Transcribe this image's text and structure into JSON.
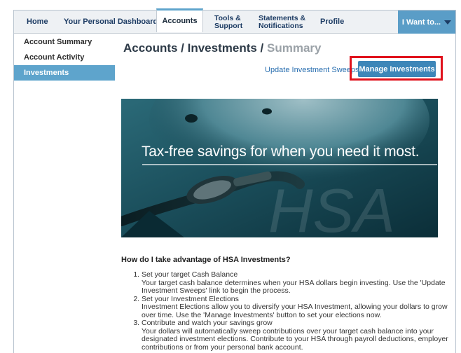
{
  "nav": {
    "items": [
      {
        "label": "Home"
      },
      {
        "label": "Your Personal Dashboard"
      },
      {
        "label": "Accounts"
      },
      {
        "line1": "Tools &",
        "line2": "Support"
      },
      {
        "line1": "Statements &",
        "line2": "Notifications"
      },
      {
        "label": "Profile"
      }
    ],
    "iwant_label": "I Want to..."
  },
  "sidebar": {
    "items": [
      {
        "label": "Account Summary"
      },
      {
        "label": "Account Activity"
      },
      {
        "label": "Investments"
      }
    ]
  },
  "main": {
    "title_primary": "Accounts / Investments /",
    "title_secondary": "Summary",
    "sweeps_link": "Update Investment Sweeps",
    "manage_button": "Manage Investments",
    "banner_text": "Tax-free savings for when you need it most.",
    "banner_watermark": "HSA",
    "question": "How do I take advantage of HSA Investments?",
    "steps": [
      {
        "title": "Set your target Cash Balance",
        "desc": "Your target cash balance determines when your HSA dollars begin investing. Use the 'Update Investment Sweeps' link to begin the process."
      },
      {
        "title": "Set your Investment Elections",
        "desc": "Investment Elections allow you to diversify your HSA Investment, allowing your dollars to grow over time. Use the 'Manage Investments' button to set your elections now."
      },
      {
        "title": "Contribute and watch your savings grow",
        "desc": "Your dollars will automatically sweep contributions over your target cash balance into your designated investment elections. Contribute to your HSA through payroll deductions, employer contributions or from your personal bank account."
      }
    ]
  },
  "colors": {
    "accent": "#5ea4cc",
    "button": "#3d86b8",
    "highlight": "#e0121c",
    "nav_text": "#1c3b63"
  }
}
